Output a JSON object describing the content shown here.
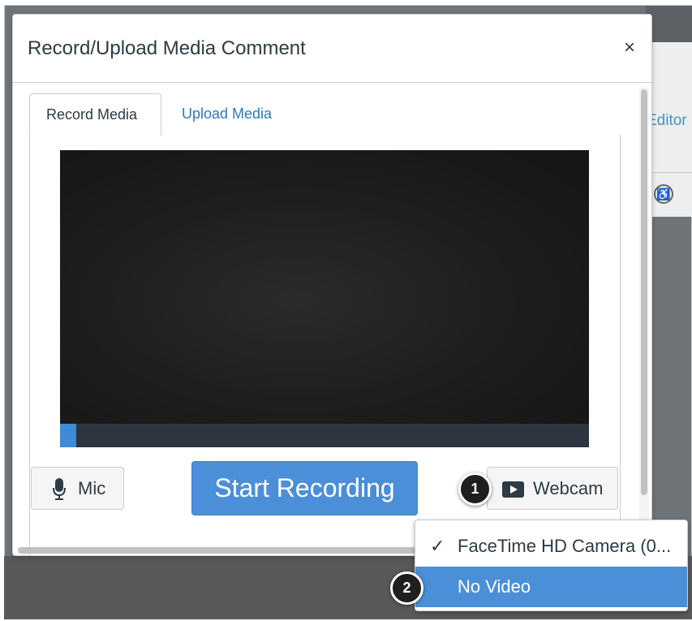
{
  "dialog": {
    "title": "Record/Upload Media Comment",
    "close_label": "×"
  },
  "tabs": [
    {
      "label": "Record Media",
      "active": true
    },
    {
      "label": "Upload Media",
      "active": false
    }
  ],
  "controls": {
    "mic_label": "Mic",
    "start_label": "Start Recording",
    "webcam_label": "Webcam"
  },
  "background": {
    "editor_fragment": "Editor"
  },
  "dropdown": {
    "items": [
      {
        "label": "FaceTime HD Camera (0...",
        "checked": true
      },
      {
        "label": "No Video",
        "highlighted": true
      }
    ]
  },
  "callouts": [
    "1",
    "2"
  ],
  "colors": {
    "primary_button": "#4a8fd8",
    "link": "#2b7abc",
    "text": "#2d3b45",
    "progress_fill": "#3d8ad6"
  },
  "icons": {
    "mic": "microphone-icon",
    "webcam": "video-play-icon",
    "check": "checkmark-icon",
    "close": "close-icon",
    "accessibility": "accessibility-icon"
  }
}
